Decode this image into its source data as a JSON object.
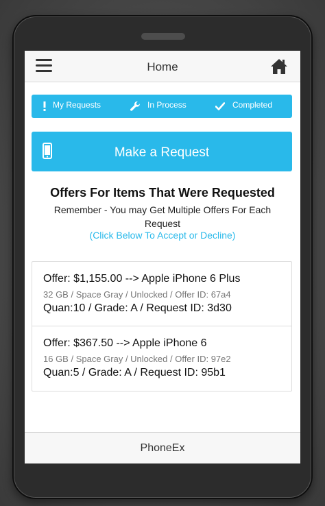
{
  "header": {
    "title": "Home",
    "menu_icon": "hamburger-menu-icon",
    "home_icon": "home-icon"
  },
  "tabs": [
    {
      "label": "My Requests",
      "icon": "exclamation-icon"
    },
    {
      "label": "In Process",
      "icon": "wrench-icon"
    },
    {
      "label": "Completed",
      "icon": "checkmark-icon"
    }
  ],
  "make_request": {
    "label": "Make a Request",
    "icon": "mobile-phone-icon"
  },
  "offers_section": {
    "title": "Offers For Items That Were Requested",
    "subtitle": "Remember - You may Get Multiple Offers For Each Request",
    "hint": "(Click Below To Accept or Decline)"
  },
  "offers": [
    {
      "line1": "Offer: $1,155.00 --> Apple iPhone 6 Plus",
      "line2": "32 GB / Space Gray / Unlocked / Offer ID: 67a4",
      "line3": "Quan:10 / Grade: A / Request ID: 3d30"
    },
    {
      "line1": "Offer: $367.50 --> Apple iPhone 6",
      "line2": "16 GB / Space Gray / Unlocked / Offer ID: 97e2",
      "line3": "Quan:5 / Grade: A / Request ID: 95b1"
    }
  ],
  "footer": {
    "label": "PhoneEx"
  },
  "colors": {
    "accent": "#29b9ea",
    "header_bg": "#f7f7f7",
    "frame": "#2c2c2c"
  }
}
